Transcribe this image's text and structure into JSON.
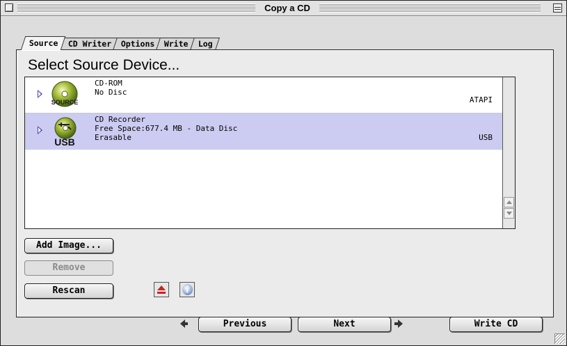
{
  "window": {
    "title": "Copy a CD"
  },
  "tabs": [
    {
      "label": "Source",
      "active": true
    },
    {
      "label": "CD Writer",
      "active": false
    },
    {
      "label": "Options",
      "active": false
    },
    {
      "label": "Write",
      "active": false
    },
    {
      "label": "Log",
      "active": false
    }
  ],
  "panel": {
    "title": "Select Source Device..."
  },
  "devices": [
    {
      "name": "CD-ROM",
      "status": "No Disc",
      "extra": "",
      "bus": "ATAPI",
      "icon": "source-cd-icon",
      "icon_label": "SOURCE",
      "selected": false
    },
    {
      "name": "CD Recorder",
      "status": "Free Space:677.4 MB - Data Disc",
      "extra": "Erasable",
      "bus": "USB",
      "icon": "usb-cd-icon",
      "icon_label": "USB",
      "selected": true
    }
  ],
  "buttons": {
    "add_image": "Add Image...",
    "remove": "Remove",
    "rescan": "Rescan",
    "previous": "Previous",
    "next": "Next",
    "write_cd": "Write CD"
  },
  "colors": {
    "selection": "#ccccf2",
    "disclosure": "#4a3fb0",
    "eject": "#d02020"
  }
}
